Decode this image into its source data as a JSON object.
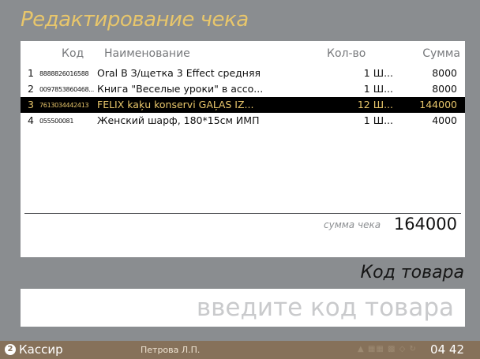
{
  "title": "Редактирование чека",
  "table": {
    "headers": {
      "code": "Код",
      "name": "Наименование",
      "qty": "Кол-во",
      "sum": "Сумма"
    },
    "rows": [
      {
        "num": "1",
        "code": "8888826016588",
        "name": "Oral B З/щетка 3 Effect средняя",
        "qty": "1 Ш...",
        "sum": "8000",
        "selected": false
      },
      {
        "num": "2",
        "code": "0097853860468...",
        "name": "Книга \"Веселые уроки\" в ассо...",
        "qty": "1 Ш...",
        "sum": "8000",
        "selected": false
      },
      {
        "num": "3",
        "code": "7613034442413",
        "name": "FELIX kaķu konservi GAĻAS IZ...",
        "qty": "12 Ш...",
        "sum": "144000",
        "selected": true
      },
      {
        "num": "4",
        "code": "055500081",
        "name": "Женский шарф, 180*15см ИМП",
        "qty": "1 Ш...",
        "sum": "4000",
        "selected": false
      }
    ]
  },
  "total": {
    "label": "сумма чека",
    "value": "164000"
  },
  "code_entry": {
    "label": "Код товара",
    "placeholder": "введите код товара"
  },
  "status": {
    "badge": "2",
    "role": "Кассир",
    "user": "Петрова Л.П.",
    "time": "04 42"
  },
  "colors": {
    "accent": "#e8c66b",
    "background": "#8a8d90",
    "status_bar": "#86715a",
    "selected_row": "#000000"
  }
}
